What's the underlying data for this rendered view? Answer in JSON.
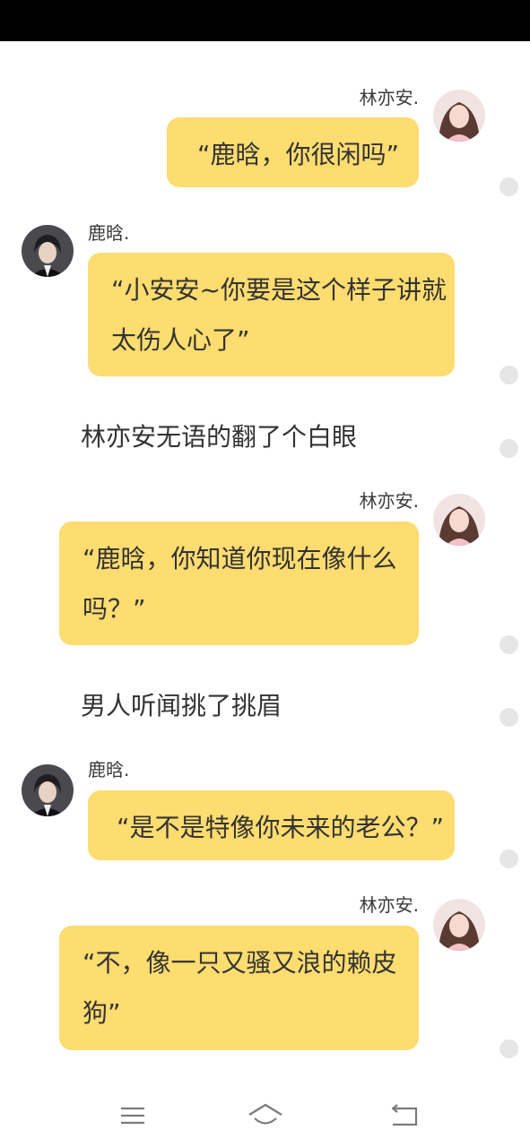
{
  "characters": {
    "her": {
      "name": "林亦安."
    },
    "him": {
      "name": "鹿晗."
    }
  },
  "messages": [
    {
      "speaker": "林亦安.",
      "lines": [
        "“鹿晗，你很闲吗”"
      ]
    },
    {
      "speaker": "鹿晗.",
      "lines": [
        "“小安安~你要是这个样子讲就",
        "太伤人心了”"
      ]
    },
    {
      "narration": "林亦安无语的翻了个白眼"
    },
    {
      "speaker": "林亦安.",
      "lines": [
        "“鹿晗，你知道你现在像什么",
        "吗？”"
      ]
    },
    {
      "narration": "男人听闻挑了挑眉"
    },
    {
      "speaker": "鹿晗.",
      "lines": [
        "“是不是特像你未来的老公？”"
      ]
    },
    {
      "speaker": "林亦安.",
      "lines": [
        "“不，像一只又骚又浪的赖皮",
        "狗”"
      ]
    }
  ],
  "colors": {
    "bubble": "#fddc70",
    "status_bar": "#000000",
    "comment_dot": "#e6e6e6"
  },
  "icons": {
    "status_bar": "none",
    "comment_dot": "comment-dot-icon",
    "nav_menu": "menu-icon",
    "nav_home": "home-icon",
    "nav_back": "back-icon"
  }
}
